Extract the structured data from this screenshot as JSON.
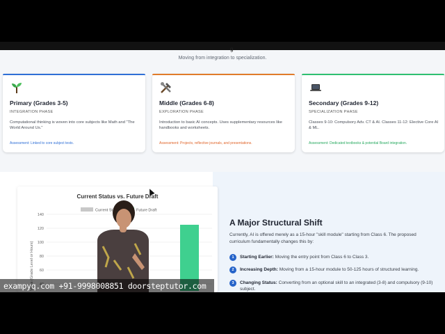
{
  "header": {
    "subtitle": "Moving from integration to specialization.",
    "title_fragment": "g"
  },
  "cards": [
    {
      "icon": "sprout-icon",
      "title": "Primary (Grades 3-5)",
      "phase": "INTEGRATION PHASE",
      "description": "Computational thinking is woven into core subjects like Math and \"The World Around Us.\"",
      "assessment": "Assessment: Linked to core subject tests.",
      "accent": "#2f6fd6",
      "assessment_color": "#2f6fd6"
    },
    {
      "icon": "tools-icon",
      "title": "Middle (Grades 6-8)",
      "phase": "EXPLORATION PHASE",
      "description": "Introduction to basic AI concepts. Uses supplementary resources like handbooks and worksheets.",
      "assessment": "Assessment: Projects, reflective journals, and presentations.",
      "accent": "#e07b2a",
      "assessment_color": "#e0652a"
    },
    {
      "icon": "laptop-icon",
      "title": "Secondary (Grades 9-12)",
      "phase": "SPECIALIZATION PHASE",
      "description": "Classes 9-10: Compulsory Adv. CT & AI. Classes 11-12: Elective Core AI & ML.",
      "assessment": "Assessment: Dedicated textbooks & potential Board integration.",
      "accent": "#2fbf71",
      "assessment_color": "#27a95f"
    }
  ],
  "chart_data": {
    "type": "bar",
    "title": "Current Status vs. Future Draft",
    "legend": [
      "Current Status",
      "Future Draft"
    ],
    "ylabel": "Value (Grade Level or Hours)",
    "yticks": [
      40,
      60,
      80,
      100,
      120,
      140
    ],
    "ylim": [
      30,
      140
    ],
    "series": [
      {
        "name": "Future Draft",
        "values": [
          125
        ],
        "color": "#3fd08f"
      }
    ],
    "legend_colors": [
      "#c8c8c8",
      "#3fd08f"
    ]
  },
  "shift": {
    "title": "A Major Structural Shift",
    "description": "Currently, AI is offered merely as a 15-hour \"skill module\" starting from Class 6. The proposed curriculum fundamentally changes this by:",
    "steps": [
      {
        "num": "1",
        "head": "Starting Earlier:",
        "text": " Moving the entry point from Class 6 to Class 3."
      },
      {
        "num": "2",
        "head": "Increasing Depth:",
        "text": " Moving from a 15-hour module to 50-125 hours of structured learning."
      },
      {
        "num": "3",
        "head": "Changing Status:",
        "text": " Converting from an optional skill to an integrated (3-8) and compulsory (9-10) subject."
      }
    ]
  },
  "watermark": "exampyq.com +91-9998008851 doorsteptutor.com"
}
